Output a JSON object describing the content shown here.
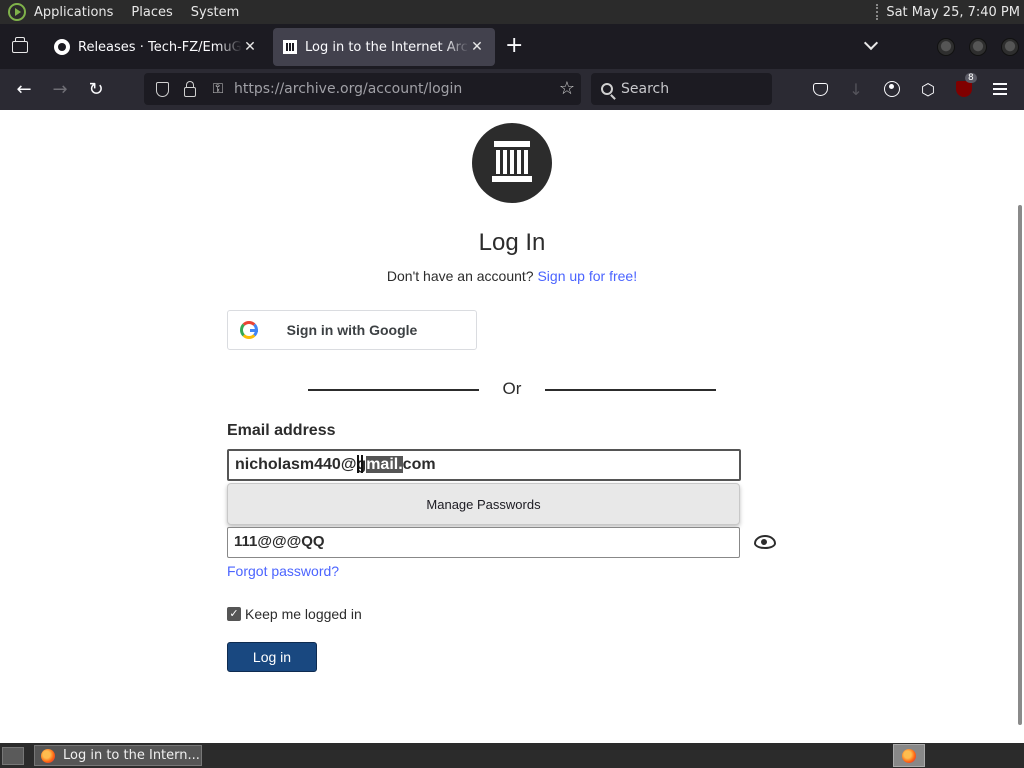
{
  "system_panel": {
    "menus": [
      "Applications",
      "Places",
      "System"
    ],
    "clock": "Sat May 25,  7:40 PM"
  },
  "browser": {
    "tabs": [
      {
        "title": "Releases · Tech-FZ/EmuGUI",
        "active": false
      },
      {
        "title": "Log in to the Internet Archive",
        "active": true
      }
    ],
    "url_host": "https://archive.org",
    "url_path": "/account/login",
    "search_placeholder": "Search",
    "extension_badge": "8"
  },
  "page": {
    "title": "Log In",
    "signup_prompt": "Don't have an account?",
    "signup_link": "Sign up for free!",
    "google_button": "Sign in with Google",
    "divider": "Or",
    "email_label": "Email address",
    "email_value_pre": "nicholasm440@g",
    "email_value_sel": "mail.",
    "email_value_post": "com",
    "autocomplete_option": "Manage Passwords",
    "password_value": "111@@@QQ",
    "forgot_link": "Forgot password?",
    "keep_logged_in": "Keep me logged in",
    "keep_logged_in_checked": true,
    "login_button": "Log in"
  },
  "taskbar": {
    "window_title": "Log in to the Intern..."
  },
  "colors": {
    "link": "#4b64ff",
    "login_button": "#194880",
    "logo": "#2c2c2c"
  }
}
